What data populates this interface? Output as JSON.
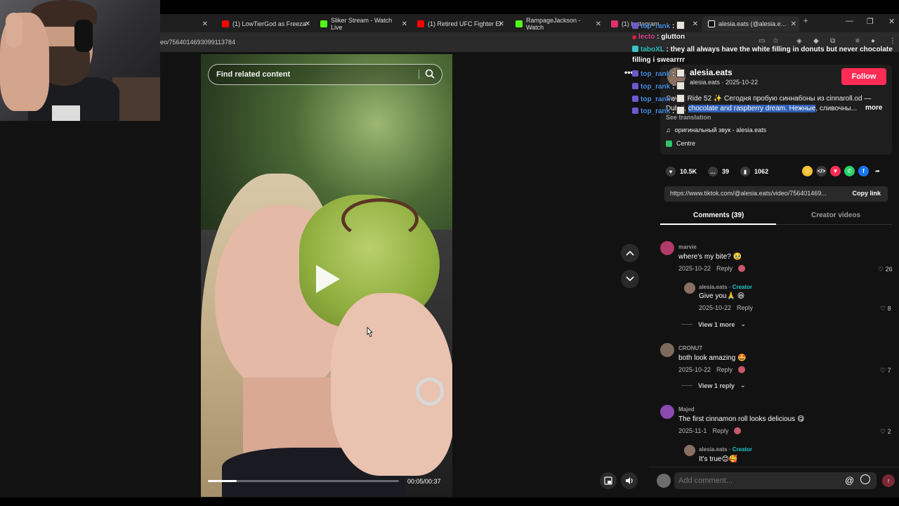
{
  "browser": {
    "tabs": [
      {
        "label": "(1) LowTierGod as Freeza",
        "color": "#ff0000"
      },
      {
        "label": "Sliker Stream - Watch Live",
        "color": "#53fc18"
      },
      {
        "label": "(1) Retired UFC Fighter El",
        "color": "#ff0000"
      },
      {
        "label": "RampageJackson - Watch",
        "color": "#53fc18"
      },
      {
        "label": "(1) Instagram",
        "color": "#e1306c"
      },
      {
        "label": "alesia.eats (@alesia.e...",
        "color": "#ffffff"
      }
    ],
    "url": "eo/7564014693099113784",
    "new_tab": "+",
    "minimize": "—",
    "restore": "❐",
    "close": "✕"
  },
  "chat": [
    {
      "user": "top_rank",
      "text": "",
      "color": "blue"
    },
    {
      "user": "lecto",
      "text": "glutton",
      "color": "pink"
    },
    {
      "user": "taboXL",
      "text": "they all always have the white filling in donuts but never chocolate",
      "color": "teal"
    },
    {
      "user": "",
      "text": "filling i swearrrr",
      "color": "teal"
    },
    {
      "user": "top_rank",
      "text": "",
      "color": "blue"
    },
    {
      "user": "top_rank",
      "text": "",
      "color": "blue"
    },
    {
      "user": "top_rank",
      "text": "",
      "color": "blue"
    },
    {
      "user": "top_rank",
      "text": "",
      "color": "blue"
    }
  ],
  "video": {
    "search_placeholder": "Find related content",
    "time": "00:05/00:37",
    "progress": 0.15
  },
  "post": {
    "author": "alesia.eats",
    "handle": "alesia.eats",
    "date": "2025-10-22",
    "follow_label": "Follow",
    "desc_line1": "Sweet Ride 52 ✨ Сегодня пробую синнабоны из cinnaroll.od —",
    "desc_line2_plain": "Dubai, ",
    "desc_line2_hl": "chocolate and raspberry dream. Нежные",
    "desc_line2_rest": ", сливочны...",
    "more_label": "more",
    "see_translation": "See translation",
    "sound": "оригинальный звук - alesia.eats",
    "location": "Centre",
    "likes": "10.5K",
    "comments": "39",
    "saves": "1062",
    "link": "https://www.tiktok.com/@alesia.eats/video/756401469...",
    "copy_label": "Copy link",
    "tab_comments": "Comments (39)",
    "tab_creator": "Creator videos"
  },
  "comments": [
    {
      "user": "marvie",
      "text": "where's my bite? 🥹",
      "date": "2025-10-22",
      "reply": "Reply",
      "likes": "26"
    },
    {
      "user": "alesia.eats",
      "creator": "Creator",
      "text": "Give you🙏 😆",
      "date": "2025-10-22",
      "reply": "Reply",
      "likes": "8"
    },
    {
      "view": "View 1 more"
    },
    {
      "user": "CRONUT",
      "text": "both look amazing 🤩",
      "date": "2025-10-22",
      "reply": "Reply",
      "likes": "7"
    },
    {
      "view": "View 1 reply"
    },
    {
      "user": "Majed",
      "text": "The first cinnamon roll looks delicious 😋",
      "date": "2025-11-1",
      "reply": "Reply",
      "likes": "2"
    },
    {
      "user": "alesia.eats",
      "creator": "Creator",
      "text": "It's true😊🥰",
      "date": "",
      "reply": "",
      "likes": ""
    }
  ],
  "composer": {
    "placeholder": "Add comment...",
    "at": "@"
  },
  "colors": {
    "accent": "#fe2c55",
    "creator": "#20c2c8",
    "background": "#121212"
  }
}
